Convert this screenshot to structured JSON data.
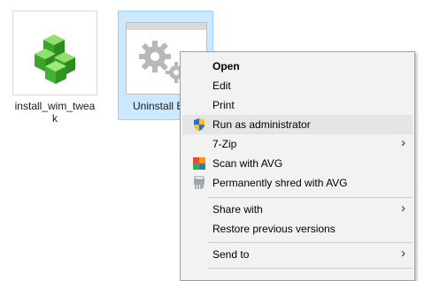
{
  "desktop": {
    "icons": [
      {
        "label": "install_wim_twea\nk",
        "type": "registry-cubes"
      },
      {
        "label": "Uninstall E",
        "type": "settings-gear"
      }
    ]
  },
  "context_menu": {
    "items": [
      {
        "label": "Open",
        "bold": true
      },
      {
        "label": "Edit"
      },
      {
        "label": "Print"
      },
      {
        "label": "Run as administrator",
        "icon": "uac-shield-icon",
        "highlighted": true
      },
      {
        "label": "7-Zip",
        "submenu": true
      },
      {
        "label": "Scan with AVG",
        "icon": "avg-icon"
      },
      {
        "label": "Permanently shred with AVG",
        "icon": "shredder-icon"
      },
      {
        "label": "Share with",
        "submenu": true
      },
      {
        "label": "Restore previous versions"
      },
      {
        "label": "Send to",
        "submenu": true
      }
    ],
    "arrow_glyph": "›"
  }
}
